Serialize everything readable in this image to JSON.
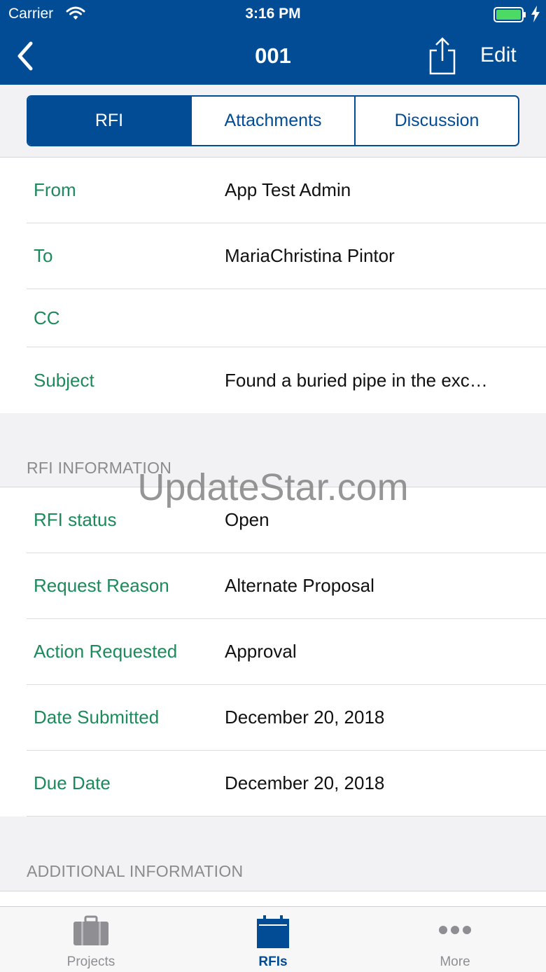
{
  "status_bar": {
    "carrier": "Carrier",
    "time": "3:16 PM"
  },
  "nav": {
    "title": "001",
    "edit_label": "Edit"
  },
  "segments": [
    "RFI",
    "Attachments",
    "Discussion"
  ],
  "top_fields": [
    {
      "label": "From",
      "value": "App Test Admin"
    },
    {
      "label": "To",
      "value": "MariaChristina Pintor"
    },
    {
      "label": "CC",
      "value": ""
    },
    {
      "label": "Subject",
      "value": "Found a buried pipe in the exc…"
    }
  ],
  "rfi_information": {
    "header": "RFI INFORMATION",
    "fields": [
      {
        "label": "RFI status",
        "value": "Open"
      },
      {
        "label": "Request Reason",
        "value": "Alternate Proposal"
      },
      {
        "label": "Action Requested",
        "value": "Approval"
      },
      {
        "label": "Date Submitted",
        "value": "December 20, 2018"
      },
      {
        "label": "Due Date",
        "value": "December 20, 2018"
      }
    ]
  },
  "additional_information": {
    "header": "ADDITIONAL INFORMATION"
  },
  "watermark": "UpdateStar.com",
  "tab_bar": {
    "items": [
      {
        "label": "Projects",
        "icon": "briefcase-icon"
      },
      {
        "label": "RFIs",
        "icon": "calendar-icon"
      },
      {
        "label": "More",
        "icon": "more-dots-icon"
      }
    ],
    "active": "RFIs"
  },
  "colors": {
    "brand": "#024c96",
    "label_green": "#1d8a5b",
    "battery_green": "#4cd964"
  }
}
